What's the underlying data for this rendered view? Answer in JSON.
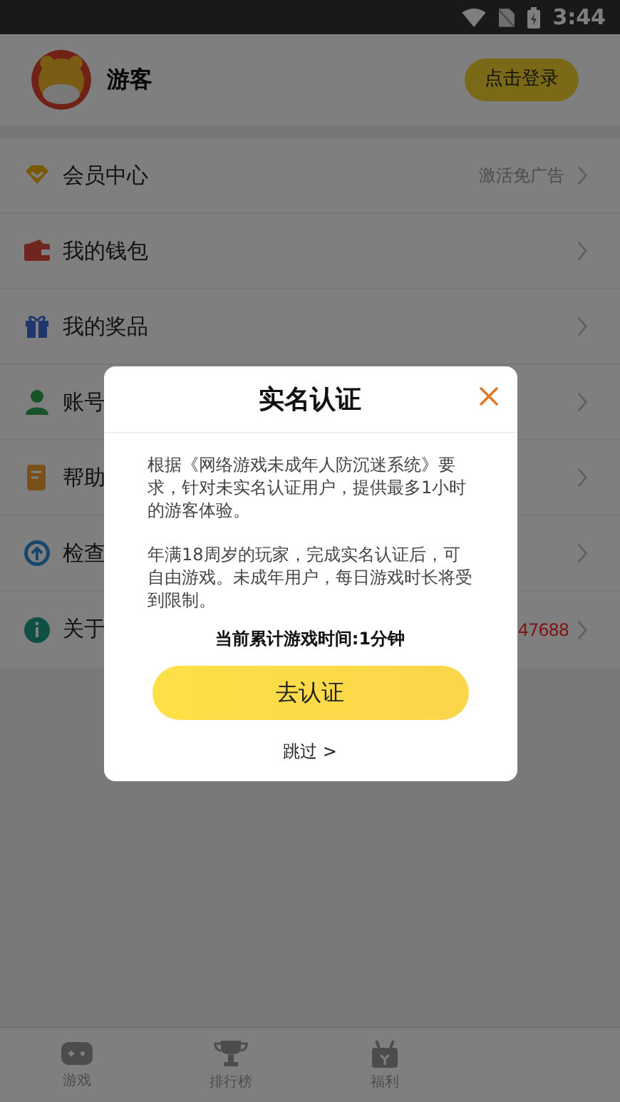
{
  "status_bar": {
    "time": "3:44"
  },
  "profile": {
    "name": "游客",
    "login_button": "点击登录"
  },
  "menu": [
    {
      "kind": "promo",
      "label": "会员中心",
      "detail": "激活免广告"
    },
    {
      "kind": "plain",
      "label": "我的钱包"
    },
    {
      "kind": "plain",
      "label": "我的奖品"
    },
    {
      "kind": "plain",
      "label": "账号"
    },
    {
      "kind": "plain",
      "label": "帮助"
    },
    {
      "kind": "plain",
      "label": "检查"
    },
    {
      "kind": "alert",
      "label": "关于",
      "detail": "47688"
    }
  ],
  "tab_bar": [
    {
      "label": "游戏",
      "selected": false
    },
    {
      "label": "排行榜",
      "selected": false
    },
    {
      "label": "福利",
      "selected": false
    }
  ],
  "dialog": {
    "title": "实名认证",
    "paragraphs": [
      "根据《网络游戏未成年人防沉迷系统》要求，针对未实名认证用户，提供最多1小时的游客体验。",
      "年满18周岁的玩家，完成实名认证后，可自由游戏。未成年用户，每日游戏时长将受到限制。"
    ],
    "play_time": "当前累计游戏时间:1分钟",
    "confirm_button": "去认证",
    "skip_link": "跳过 >"
  }
}
